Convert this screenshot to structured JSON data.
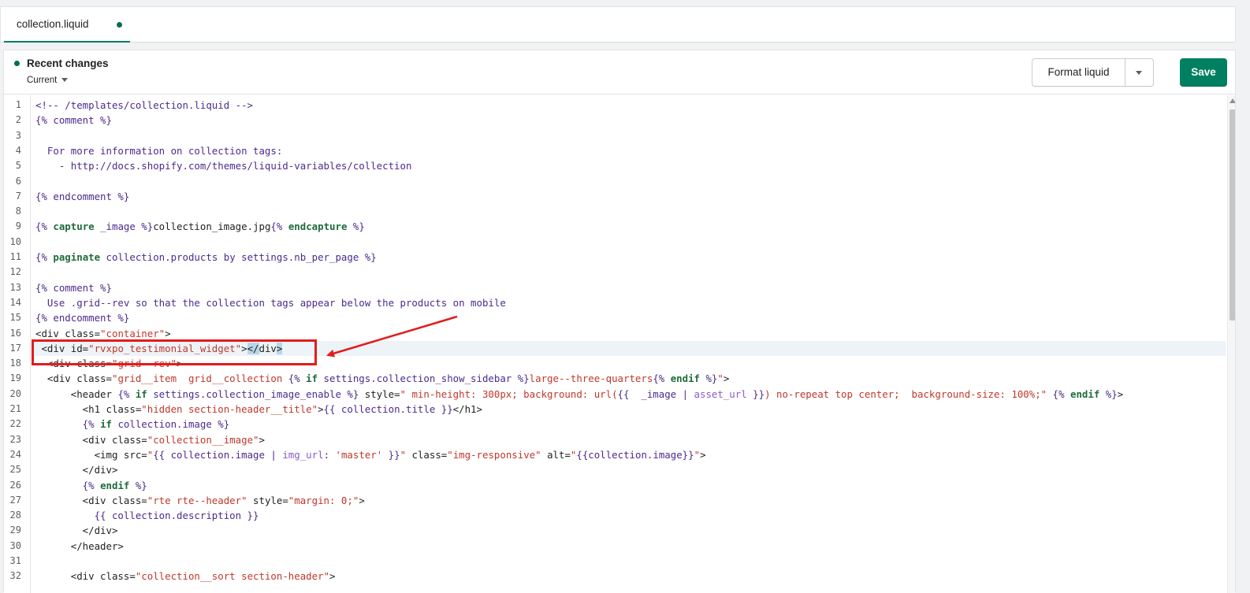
{
  "tab": {
    "label": "collection.liquid"
  },
  "header": {
    "title": "Recent changes",
    "version": "Current",
    "format_label": "Format liquid",
    "save_label": "Save"
  },
  "colors": {
    "accent": "#008060",
    "comment": "#4b2b8c",
    "keyword": "#1f6b3c",
    "string": "#c0382b",
    "filter": "#8a5bc7",
    "annotation": "#e11d1d"
  },
  "icons": {
    "unsaved": "dot-icon",
    "version_menu": "chevron-down-icon",
    "format_menu": "chevron-down-icon"
  },
  "code": {
    "active_line": 17,
    "lines": [
      {
        "n": "1",
        "parts": [
          [
            "cm",
            "<!-- /templates/collection.liquid -->"
          ]
        ]
      },
      {
        "n": "2",
        "parts": [
          [
            "cm",
            "{% comment %}"
          ]
        ]
      },
      {
        "n": "3",
        "parts": []
      },
      {
        "n": "4",
        "parts": [
          [
            "cm",
            "  For more information on collection tags:"
          ]
        ]
      },
      {
        "n": "5",
        "parts": [
          [
            "cm",
            "    - http://docs.shopify.com/themes/liquid-variables/collection"
          ]
        ]
      },
      {
        "n": "6",
        "parts": []
      },
      {
        "n": "7",
        "parts": [
          [
            "cm",
            "{% endcomment %}"
          ]
        ]
      },
      {
        "n": "8",
        "parts": []
      },
      {
        "n": "9",
        "parts": [
          [
            "cm",
            "{% "
          ],
          [
            "kw",
            "capture"
          ],
          [
            "cm",
            " _image %}"
          ],
          [
            "tag",
            "collection_image.jpg"
          ],
          [
            "cm",
            "{% "
          ],
          [
            "kw",
            "endcapture"
          ],
          [
            "cm",
            " %}"
          ]
        ]
      },
      {
        "n": "10",
        "parts": []
      },
      {
        "n": "11",
        "parts": [
          [
            "cm",
            "{% "
          ],
          [
            "kw",
            "paginate"
          ],
          [
            "cm",
            " collection.products by settings.nb_per_page %}"
          ]
        ]
      },
      {
        "n": "12",
        "parts": []
      },
      {
        "n": "13",
        "parts": [
          [
            "cm",
            "{% comment %}"
          ]
        ]
      },
      {
        "n": "14",
        "parts": [
          [
            "cm",
            "  Use .grid--rev so that the collection tags appear below the products on mobile"
          ]
        ]
      },
      {
        "n": "15",
        "parts": [
          [
            "cm",
            "{% endcomment %}"
          ]
        ]
      },
      {
        "n": "16",
        "parts": [
          [
            "tag",
            "<div class="
          ],
          [
            "str",
            "\"container\""
          ],
          [
            "tag",
            ">"
          ]
        ]
      },
      {
        "n": "17",
        "parts": [
          [
            "tag",
            " <div id="
          ],
          [
            "str",
            "\"rvxpo_testimonial_widget\""
          ],
          [
            "tag",
            ">"
          ],
          [
            "bh",
            "</"
          ],
          [
            "tag",
            "div"
          ],
          [
            "bh",
            ">"
          ]
        ]
      },
      {
        "n": "18",
        "parts": [
          [
            "tag",
            "  <div class="
          ],
          [
            "str",
            "\"grid--rev\""
          ],
          [
            "tag",
            ">"
          ]
        ]
      },
      {
        "n": "19",
        "parts": [
          [
            "tag",
            "  <div class="
          ],
          [
            "str",
            "\"grid__item  grid__collection "
          ],
          [
            "cm",
            "{% "
          ],
          [
            "kw",
            "if"
          ],
          [
            "cm",
            " settings.collection_show_sidebar %}"
          ],
          [
            "str",
            "large--three-quarters"
          ],
          [
            "cm",
            "{% "
          ],
          [
            "kw",
            "endif"
          ],
          [
            "cm",
            " %}"
          ],
          [
            "str",
            "\""
          ],
          [
            "tag",
            ">"
          ]
        ]
      },
      {
        "n": "20",
        "parts": [
          [
            "tag",
            "      <header "
          ],
          [
            "cm",
            "{% "
          ],
          [
            "kw",
            "if"
          ],
          [
            "cm",
            " settings.collection_image_enable %}"
          ],
          [
            "tag",
            " style="
          ],
          [
            "str",
            "\" min-height: 300px; background: url("
          ],
          [
            "cm",
            "{{  _image | "
          ],
          [
            "fl",
            "asset_url"
          ],
          [
            "cm",
            " }}"
          ],
          [
            "str",
            ") no-repeat top center;  background-size: 100%;\""
          ],
          [
            "tag",
            " "
          ],
          [
            "cm",
            "{% "
          ],
          [
            "kw",
            "endif"
          ],
          [
            "cm",
            " %}"
          ],
          [
            "tag",
            ">"
          ]
        ]
      },
      {
        "n": "21",
        "parts": [
          [
            "tag",
            "        <h1 class="
          ],
          [
            "str",
            "\"hidden section-header__title\""
          ],
          [
            "tag",
            ">"
          ],
          [
            "cm",
            "{{ collection.title }}"
          ],
          [
            "tag",
            "</h1>"
          ]
        ]
      },
      {
        "n": "22",
        "parts": [
          [
            "cm",
            "        {% "
          ],
          [
            "kw",
            "if"
          ],
          [
            "cm",
            " collection.image %}"
          ]
        ]
      },
      {
        "n": "23",
        "parts": [
          [
            "tag",
            "        <div class="
          ],
          [
            "str",
            "\"collection__image\""
          ],
          [
            "tag",
            ">"
          ]
        ]
      },
      {
        "n": "24",
        "parts": [
          [
            "tag",
            "          <img src="
          ],
          [
            "str",
            "\""
          ],
          [
            "cm",
            "{{ collection.image | "
          ],
          [
            "fl",
            "img_url"
          ],
          [
            "cm",
            ": "
          ],
          [
            "str",
            "'master'"
          ],
          [
            "cm",
            " }}"
          ],
          [
            "str",
            "\""
          ],
          [
            "tag",
            " class="
          ],
          [
            "str",
            "\"img-responsive\""
          ],
          [
            "tag",
            " alt="
          ],
          [
            "str",
            "\""
          ],
          [
            "cm",
            "{{collection.image}}"
          ],
          [
            "str",
            "\""
          ],
          [
            "tag",
            ">"
          ]
        ]
      },
      {
        "n": "25",
        "parts": [
          [
            "tag",
            "        </div>"
          ]
        ]
      },
      {
        "n": "26",
        "parts": [
          [
            "cm",
            "        {% "
          ],
          [
            "kw",
            "endif"
          ],
          [
            "cm",
            " %}"
          ]
        ]
      },
      {
        "n": "27",
        "parts": [
          [
            "tag",
            "        <div class="
          ],
          [
            "str",
            "\"rte rte--header\""
          ],
          [
            "tag",
            " style="
          ],
          [
            "str",
            "\"margin: 0;\""
          ],
          [
            "tag",
            ">"
          ]
        ]
      },
      {
        "n": "28",
        "parts": [
          [
            "cm",
            "          {{ collection.description }}"
          ]
        ]
      },
      {
        "n": "29",
        "parts": [
          [
            "tag",
            "        </div>"
          ]
        ]
      },
      {
        "n": "30",
        "parts": [
          [
            "tag",
            "      </header>"
          ]
        ]
      },
      {
        "n": "31",
        "parts": []
      },
      {
        "n": "32",
        "parts": [
          [
            "tag",
            "      <div class="
          ],
          [
            "str",
            "\"collection__sort section-header\""
          ],
          [
            "tag",
            ">"
          ]
        ]
      }
    ]
  }
}
